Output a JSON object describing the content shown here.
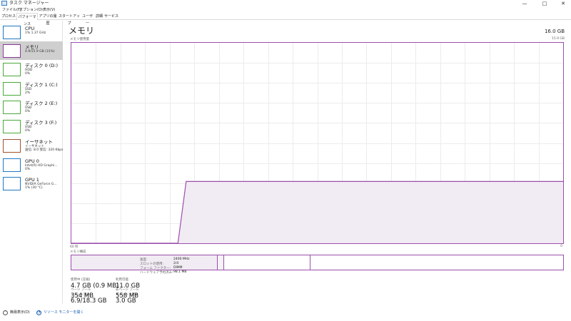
{
  "window": {
    "title": "タスク マネージャー",
    "minimize": "—",
    "maximize": "□",
    "close": "✕"
  },
  "menu": [
    "ファイル(F)",
    "オプション(O)",
    "表示(V)"
  ],
  "tabs": [
    "プロセス",
    "パフォーマンス",
    "アプリの履歴",
    "スタートアップ",
    "ユーザー",
    "詳細",
    "サービス"
  ],
  "active_tab": 1,
  "sidebar": [
    {
      "title": "CPU",
      "sub1": "1%  1.37 GHz",
      "sub2": "",
      "color": "#1f77c4",
      "selected": false,
      "icon": "cpu-graph-icon"
    },
    {
      "title": "メモリ",
      "sub1": "4.9/15.9 GB (31%)",
      "sub2": "",
      "color": "#8b3a9b",
      "selected": true,
      "icon": "memory-graph-icon"
    },
    {
      "title": "ディスク 0 (D:)",
      "sub1": "HDD",
      "sub2": "0%",
      "color": "#4aa93a",
      "selected": false,
      "icon": "disk-graph-icon"
    },
    {
      "title": "ディスク 1 (C:)",
      "sub1": "SSD",
      "sub2": "2%",
      "color": "#4aa93a",
      "selected": false,
      "icon": "disk-graph-icon"
    },
    {
      "title": "ディスク 2 (E:)",
      "sub1": "USB",
      "sub2": "0%",
      "color": "#4aa93a",
      "selected": false,
      "icon": "disk-graph-icon"
    },
    {
      "title": "ディスク 3 (F:)",
      "sub1": "USB",
      "sub2": "0%",
      "color": "#4aa93a",
      "selected": false,
      "icon": "disk-graph-icon"
    },
    {
      "title": "イーサネット",
      "sub1": "イーサネット",
      "sub2": "送信: 8.0  受信: 320 Kbps",
      "color": "#a0522d",
      "selected": false,
      "icon": "ethernet-graph-icon"
    },
    {
      "title": "GPU 0",
      "sub1": "Intel(R) HD Graphi...",
      "sub2": "0%",
      "color": "#1f77c4",
      "selected": false,
      "icon": "gpu-graph-icon"
    },
    {
      "title": "GPU 1",
      "sub1": "NVIDIA GeForce G...",
      "sub2": "1% (30 °C)",
      "color": "#1f77c4",
      "selected": false,
      "icon": "gpu-graph-icon"
    }
  ],
  "main": {
    "title": "メモリ",
    "total": "16.0 GB",
    "usage_label": "メモリ使用量",
    "usage_max": "15.9 GB",
    "time_left": "60 秒",
    "time_right": "0",
    "composition_label": "メモリ構成",
    "stats": [
      {
        "label": "使用中 (圧縮)",
        "value": "4.7 GB (0.9 MB)"
      },
      {
        "label": "利用可能",
        "value": "11.0 GB"
      },
      {
        "label": "コミット済み",
        "value": "6.9/18.3 GB"
      },
      {
        "label": "キャッシュ済み",
        "value": "3.0 GB"
      },
      {
        "label": "ページ プール",
        "value": "354 MB"
      },
      {
        "label": "非ページ プール",
        "value": "558 MB"
      }
    ],
    "properties": [
      {
        "key": "速度:",
        "value": "2400 MHz"
      },
      {
        "key": "スロットの使用:",
        "value": "2/4"
      },
      {
        "key": "フォーム ファクター:",
        "value": "DIMM"
      },
      {
        "key": "ハードウェア予約済み:",
        "value": "98.1 MB"
      }
    ]
  },
  "footer": {
    "fewer_details": "簡易表示(D)",
    "resource_monitor": "リソース モニターを開く"
  },
  "colors": {
    "accent": "#9b4fac",
    "fill": "#f1ebf3",
    "grid": "#ececec",
    "link": "#1a5fb4"
  },
  "chart_data": {
    "type": "area",
    "title": "メモリ使用量",
    "xlabel": "",
    "ylabel": "",
    "x": [
      60,
      47,
      46,
      45,
      0
    ],
    "y": [
      0,
      0,
      4.9,
      4.9,
      4.9
    ],
    "xlim": [
      60,
      0
    ],
    "ylim": [
      0,
      15.9
    ],
    "grid": true
  }
}
